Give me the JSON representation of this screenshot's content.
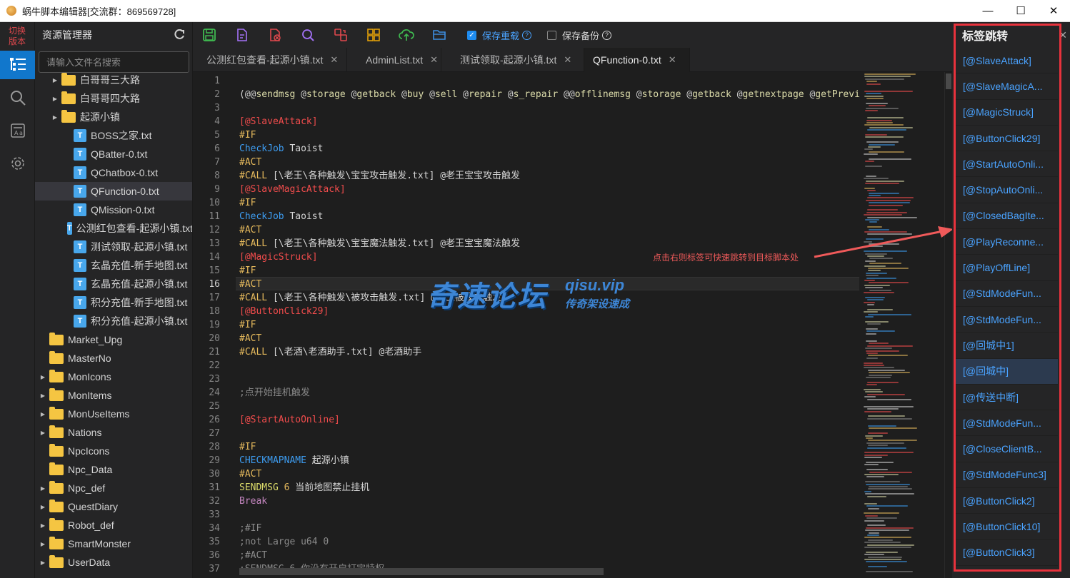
{
  "window": {
    "title": "蜗牛脚本编辑器[交流群：869569728]",
    "controls": [
      "—",
      "☐",
      "✕"
    ]
  },
  "activity": {
    "switch_label": "切换\n版本",
    "icons": [
      "explorer-icon",
      "search-icon",
      "format-icon",
      "settings-icon"
    ]
  },
  "explorer": {
    "title": "资源管理器",
    "search_placeholder": "请输入文件名搜索",
    "tree": [
      {
        "type": "folder",
        "label": "白哥哥三大路",
        "indent": 1,
        "caret": true
      },
      {
        "type": "folder",
        "label": "白哥哥四大路",
        "indent": 1,
        "caret": true
      },
      {
        "type": "folder",
        "label": "起源小镇",
        "indent": 1,
        "caret": true
      },
      {
        "type": "file",
        "label": "BOSS之家.txt",
        "indent": 2
      },
      {
        "type": "file",
        "label": "QBatter-0.txt",
        "indent": 2
      },
      {
        "type": "file",
        "label": "QChatbox-0.txt",
        "indent": 2
      },
      {
        "type": "file",
        "label": "QFunction-0.txt",
        "indent": 2,
        "selected": true
      },
      {
        "type": "file",
        "label": "QMission-0.txt",
        "indent": 2
      },
      {
        "type": "file",
        "label": "公测红包查看-起源小镇.txt",
        "indent": 2
      },
      {
        "type": "file",
        "label": "测试领取-起源小镇.txt",
        "indent": 2
      },
      {
        "type": "file",
        "label": "玄晶充值-新手地图.txt",
        "indent": 2
      },
      {
        "type": "file",
        "label": "玄晶充值-起源小镇.txt",
        "indent": 2
      },
      {
        "type": "file",
        "label": "积分充值-新手地图.txt",
        "indent": 2
      },
      {
        "type": "file",
        "label": "积分充值-起源小镇.txt",
        "indent": 2
      },
      {
        "type": "folder",
        "label": "Market_Upg",
        "indent": 0,
        "caret": false
      },
      {
        "type": "folder",
        "label": "MasterNo",
        "indent": 0,
        "caret": false
      },
      {
        "type": "folder",
        "label": "MonIcons",
        "indent": 0,
        "caret": true
      },
      {
        "type": "folder",
        "label": "MonItems",
        "indent": 0,
        "caret": true
      },
      {
        "type": "folder",
        "label": "MonUseItems",
        "indent": 0,
        "caret": true
      },
      {
        "type": "folder",
        "label": "Nations",
        "indent": 0,
        "caret": true
      },
      {
        "type": "folder",
        "label": "NpcIcons",
        "indent": 0,
        "caret": false
      },
      {
        "type": "folder",
        "label": "Npc_Data",
        "indent": 0,
        "caret": false
      },
      {
        "type": "folder",
        "label": "Npc_def",
        "indent": 0,
        "caret": true
      },
      {
        "type": "folder",
        "label": "QuestDiary",
        "indent": 0,
        "caret": true
      },
      {
        "type": "folder",
        "label": "Robot_def",
        "indent": 0,
        "caret": true
      },
      {
        "type": "folder",
        "label": "SmartMonster",
        "indent": 0,
        "caret": true
      },
      {
        "type": "folder",
        "label": "UserData",
        "indent": 0,
        "caret": true
      }
    ]
  },
  "toolbar": {
    "icons": [
      {
        "name": "save-icon",
        "color": "#3fb950"
      },
      {
        "name": "edit-file-icon",
        "color": "#a371f7"
      },
      {
        "name": "close-file-icon",
        "color": "#e0484d"
      },
      {
        "name": "search-icon",
        "color": "#a371f7"
      },
      {
        "name": "replace-icon",
        "color": "#e0484d"
      },
      {
        "name": "grid-icon",
        "color": "#e3a008"
      },
      {
        "name": "upload-icon",
        "color": "#3fb950"
      },
      {
        "name": "folder-open-icon",
        "color": "#3d8ee0"
      }
    ],
    "save_reload": {
      "label": "保存重载",
      "checked": true
    },
    "save_backup": {
      "label": "保存备份",
      "checked": false
    }
  },
  "tabs": [
    {
      "label": "公测红包查看-起源小镇.txt",
      "modified": true,
      "active": false
    },
    {
      "label": "AdminList.txt",
      "modified": false,
      "active": false
    },
    {
      "label": "测试领取-起源小镇.txt",
      "modified": false,
      "active": false
    },
    {
      "label": "QFunction-0.txt",
      "modified": false,
      "active": true
    }
  ],
  "editor": {
    "current_line": 16,
    "lines": [
      {
        "n": 1,
        "t": [
          [
            "",
            "#d4d4d4"
          ]
        ]
      },
      {
        "n": 2,
        "t": [
          [
            "(@@",
            "#d4d4d4"
          ],
          [
            "sendmsg",
            "#dcdcaa"
          ],
          [
            " @",
            "#d4d4d4"
          ],
          [
            "storage",
            "#dcdcaa"
          ],
          [
            " @",
            "#d4d4d4"
          ],
          [
            "getback",
            "#dcdcaa"
          ],
          [
            " @",
            "#d4d4d4"
          ],
          [
            "buy",
            "#dcdcaa"
          ],
          [
            " @",
            "#d4d4d4"
          ],
          [
            "sell",
            "#dcdcaa"
          ],
          [
            " @",
            "#d4d4d4"
          ],
          [
            "repair",
            "#dcdcaa"
          ],
          [
            " @",
            "#d4d4d4"
          ],
          [
            "s_repair",
            "#dcdcaa"
          ],
          [
            " @@",
            "#d4d4d4"
          ],
          [
            "offlinemsg",
            "#dcdcaa"
          ],
          [
            " @",
            "#d4d4d4"
          ],
          [
            "storage",
            "#dcdcaa"
          ],
          [
            " @",
            "#d4d4d4"
          ],
          [
            "getback",
            "#dcdcaa"
          ],
          [
            " @",
            "#d4d4d4"
          ],
          [
            "getnextpage",
            "#dcdcaa"
          ],
          [
            " @",
            "#d4d4d4"
          ],
          [
            "getPreviou",
            "#dcdcaa"
          ]
        ]
      },
      {
        "n": 3,
        "t": [
          [
            "",
            "#d4d4d4"
          ]
        ]
      },
      {
        "n": 4,
        "t": [
          [
            "[@SlaveAttack]",
            "#f14c4c"
          ]
        ]
      },
      {
        "n": 5,
        "t": [
          [
            "#IF",
            "#e5b95c"
          ]
        ]
      },
      {
        "n": 6,
        "t": [
          [
            "CheckJob",
            "#3d9cf0"
          ],
          [
            " Taoist",
            "#d4d4d4"
          ]
        ]
      },
      {
        "n": 7,
        "t": [
          [
            "#ACT",
            "#e5b95c"
          ]
        ]
      },
      {
        "n": 8,
        "t": [
          [
            "#CALL",
            "#e5b95c"
          ],
          [
            " [\\老王\\各种触发\\宝宝攻击触发.txt] @老王宝宝攻击触发",
            "#d4d4d4"
          ]
        ]
      },
      {
        "n": 9,
        "t": [
          [
            "[@SlaveMagicAttack]",
            "#f14c4c"
          ]
        ]
      },
      {
        "n": 10,
        "t": [
          [
            "#IF",
            "#e5b95c"
          ]
        ]
      },
      {
        "n": 11,
        "t": [
          [
            "CheckJob",
            "#3d9cf0"
          ],
          [
            " Taoist",
            "#d4d4d4"
          ]
        ]
      },
      {
        "n": 12,
        "t": [
          [
            "#ACT",
            "#e5b95c"
          ]
        ]
      },
      {
        "n": 13,
        "t": [
          [
            "#CALL",
            "#e5b95c"
          ],
          [
            " [\\老王\\各种触发\\宝宝魔法触发.txt] @老王宝宝魔法触发",
            "#d4d4d4"
          ]
        ]
      },
      {
        "n": 14,
        "t": [
          [
            "[@MagicStruck]",
            "#f14c4c"
          ]
        ]
      },
      {
        "n": 15,
        "t": [
          [
            "#IF",
            "#e5b95c"
          ]
        ]
      },
      {
        "n": 16,
        "t": [
          [
            "#ACT",
            "#e5b95c"
          ]
        ]
      },
      {
        "n": 17,
        "t": [
          [
            "#CALL",
            "#e5b95c"
          ],
          [
            " [\\老王\\各种触发\\被攻击触发.txt] @老王被攻击触发",
            "#d4d4d4"
          ]
        ]
      },
      {
        "n": 18,
        "t": [
          [
            "[@ButtonClick29]",
            "#f14c4c"
          ]
        ]
      },
      {
        "n": 19,
        "t": [
          [
            "#IF",
            "#e5b95c"
          ]
        ]
      },
      {
        "n": 20,
        "t": [
          [
            "#ACT",
            "#e5b95c"
          ]
        ]
      },
      {
        "n": 21,
        "t": [
          [
            "#CALL",
            "#e5b95c"
          ],
          [
            " [\\老酒\\老酒助手.txt] @老酒助手",
            "#d4d4d4"
          ]
        ]
      },
      {
        "n": 22,
        "t": [
          [
            "",
            "#d4d4d4"
          ]
        ]
      },
      {
        "n": 23,
        "t": [
          [
            "",
            "#d4d4d4"
          ]
        ]
      },
      {
        "n": 24,
        "t": [
          [
            ";点开始挂机触发",
            "#8a8a8a"
          ]
        ]
      },
      {
        "n": 25,
        "t": [
          [
            "",
            "#d4d4d4"
          ]
        ]
      },
      {
        "n": 26,
        "t": [
          [
            "[@StartAutoOnline]",
            "#f14c4c"
          ]
        ]
      },
      {
        "n": 27,
        "t": [
          [
            "",
            "#d4d4d4"
          ]
        ]
      },
      {
        "n": 28,
        "t": [
          [
            "#IF",
            "#e5b95c"
          ]
        ]
      },
      {
        "n": 29,
        "t": [
          [
            "CHECKMAPNAME",
            "#3d9cf0"
          ],
          [
            " 起源小镇",
            "#d4d4d4"
          ]
        ]
      },
      {
        "n": 30,
        "t": [
          [
            "#ACT",
            "#e5b95c"
          ]
        ]
      },
      {
        "n": 31,
        "t": [
          [
            "SENDMSG",
            "#dcdc6a"
          ],
          [
            " 6",
            "#e5b95c"
          ],
          [
            " 当前地图禁止挂机",
            "#d4d4d4"
          ]
        ]
      },
      {
        "n": 32,
        "t": [
          [
            "Break",
            "#c586c0"
          ]
        ]
      },
      {
        "n": 33,
        "t": [
          [
            "",
            "#d4d4d4"
          ]
        ]
      },
      {
        "n": 34,
        "t": [
          [
            ";#IF",
            "#8a8a8a"
          ]
        ]
      },
      {
        "n": 35,
        "t": [
          [
            ";not Large u64 0",
            "#8a8a8a"
          ]
        ]
      },
      {
        "n": 36,
        "t": [
          [
            ";#ACT",
            "#8a8a8a"
          ]
        ]
      },
      {
        "n": 37,
        "t": [
          [
            ";SENDMSG 6 你没有开启打宝特权",
            "#8a8a8a"
          ]
        ]
      }
    ]
  },
  "annotation": "点击右则标签可快速跳转到目标脚本处",
  "watermark": {
    "big": "奇速论坛",
    "url": "qisu.vip",
    "sub": "传奇架设速成"
  },
  "right_panel": {
    "title": "标签跳转",
    "labels": [
      "[@SlaveAttack]",
      "[@SlaveMagicA...",
      "[@MagicStruck]",
      "[@ButtonClick29]",
      "[@StartAutoOnli...",
      "[@StopAutoOnli...",
      "[@ClosedBagIte...",
      "[@PlayReconne...",
      "[@PlayOffLine]",
      "[@StdModeFun...",
      "[@StdModeFun...",
      "[@回城中1]",
      "[@回城中]",
      "[@传送中断]",
      "[@StdModeFun...",
      "[@CloseClientB...",
      "[@StdModeFunc3]",
      "[@ButtonClick2]",
      "[@ButtonClick10]",
      "[@ButtonClick3]"
    ],
    "active_index": 12
  },
  "colors": {
    "accent": "#1177cc",
    "label_blue": "#4aa3ff",
    "red_frame": "#e8323c"
  }
}
